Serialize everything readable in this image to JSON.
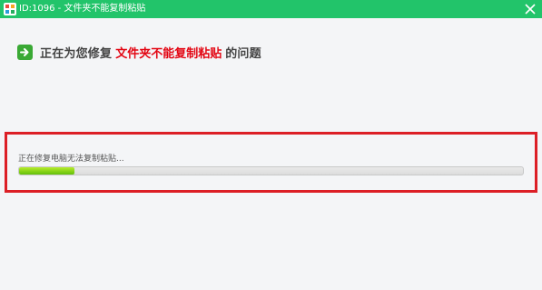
{
  "window": {
    "title": "ID:1096 - 文件夹不能复制粘贴",
    "titlebar_color": "#22c46a",
    "app_icon": "grid-app-icon",
    "close_icon": "close-icon"
  },
  "headline": {
    "prefix": "正在为您修复",
    "highlight": "文件夹不能复制粘贴",
    "suffix": "的问题",
    "icon": "arrow-right-icon",
    "highlight_color": "#e30613"
  },
  "progress": {
    "status": "正在修复电脑无法复制粘贴...",
    "percent": 11
  },
  "highlight_box_color": "#dc1f26"
}
